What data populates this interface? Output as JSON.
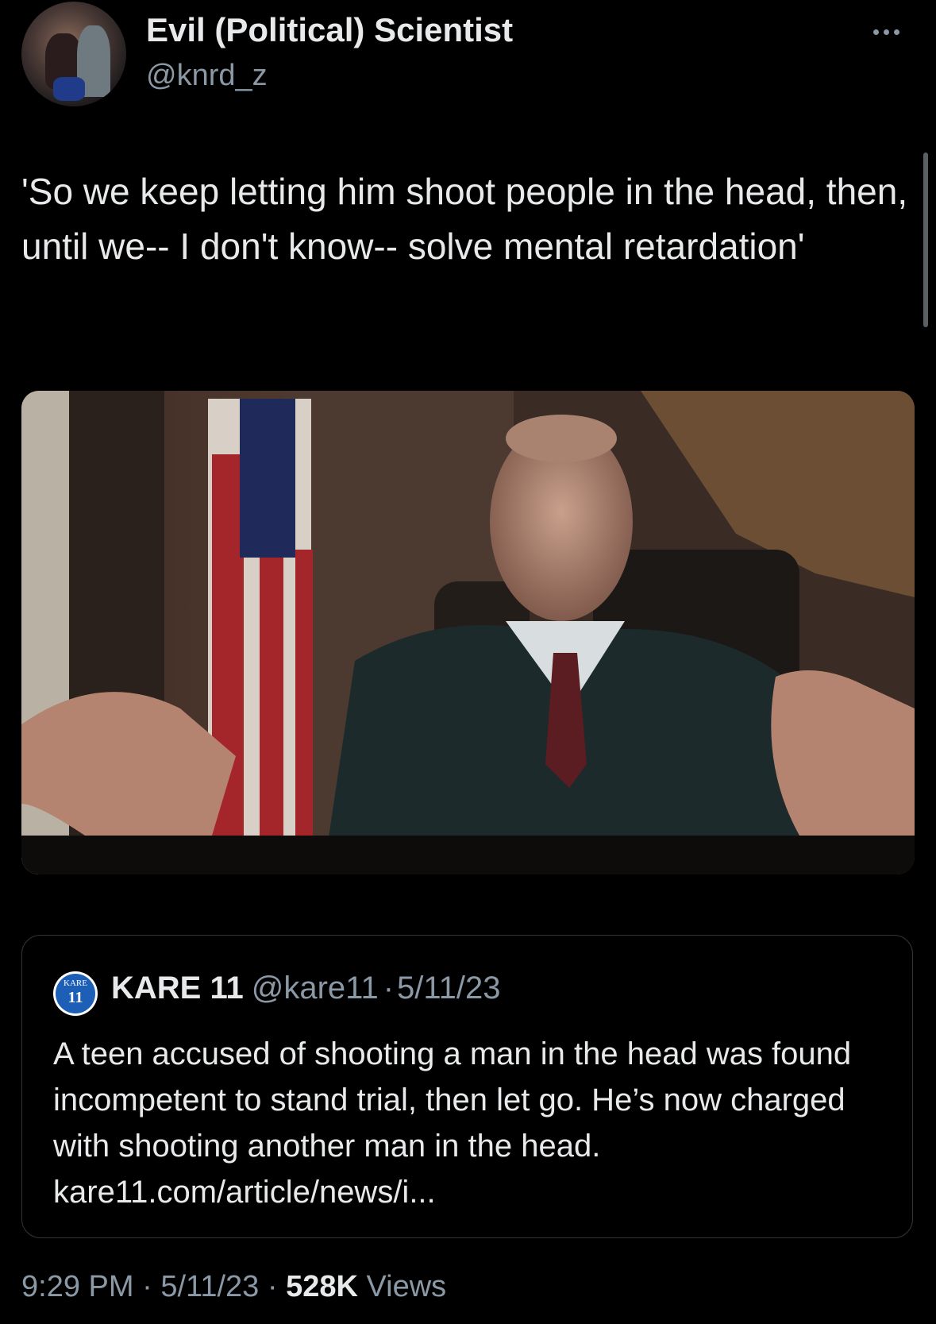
{
  "author": {
    "name": "Evil (Political) Scientist",
    "handle": "@knrd_z",
    "avatar_icon": "profile-photo"
  },
  "tweet": {
    "text": "'So we keep letting him shoot people in the head, then, until we-- I don't know-- solve mental retardation'",
    "media_alt": "photo of man in suit at desk with flag"
  },
  "quoted_tweet": {
    "logo_text": "KARE",
    "logo_number": "11",
    "name": "KARE 11",
    "handle": "@kare11",
    "separator": "·",
    "date": "5/11/23",
    "text": "A teen accused of shooting a man in the head was found incompetent to stand trial, then let go. He’s now charged with shooting another man in the head. kare11.com/article/news/i..."
  },
  "footer": {
    "time": "9:29 PM",
    "sep1": " · ",
    "date": "5/11/23",
    "sep2": " · ",
    "views_count": "528K",
    "views_label": " Views"
  },
  "colors": {
    "background": "#000000",
    "text_primary": "#e7e9ea",
    "text_secondary": "#8b98a5",
    "border": "#333639"
  }
}
